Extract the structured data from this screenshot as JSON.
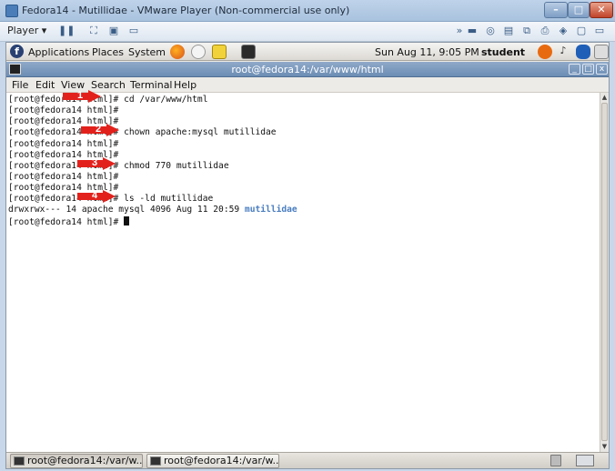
{
  "vm": {
    "title": "Fedora14 - Mutillidae - VMware Player (Non-commercial use only)",
    "player_label": "Player ▾",
    "min": "–",
    "max": "□",
    "close": "✕"
  },
  "panel": {
    "applications": "Applications",
    "places": "Places",
    "system": "System",
    "datetime": "Sun Aug 11,  9:05 PM",
    "user": "student"
  },
  "terminal": {
    "title": "root@fedora14:/var/www/html",
    "menu": [
      "File",
      "Edit",
      "View",
      "Search",
      "Terminal",
      "Help"
    ],
    "lines": [
      "[root@fedora14 html]# cd /var/www/html",
      "[root@fedora14 html]#",
      "[root@fedora14 html]#",
      "[root@fedora14 html]# chown apache:mysql mutillidae",
      "[root@fedora14 html]#",
      "[root@fedora14 html]#",
      "[root@fedora14 html]# chmod 770 mutillidae",
      "[root@fedora14 html]#",
      "[root@fedora14 html]#",
      "[root@fedora14 html]# ls -ld mutillidae"
    ],
    "ls_output_prefix": "drwxrwx--- 14 apache mysql 4096 Aug 11 20:59 ",
    "ls_output_name": "mutillidae",
    "prompt": "[root@fedora14 html]# "
  },
  "annotations": [
    "1",
    "2",
    "3",
    "4"
  ],
  "taskbar": {
    "items": [
      "root@fedora14:/var/w...",
      "root@fedora14:/var/w..."
    ]
  },
  "colors": {
    "annotation_red": "#e3211c",
    "dir_blue": "#4a7ec0"
  }
}
